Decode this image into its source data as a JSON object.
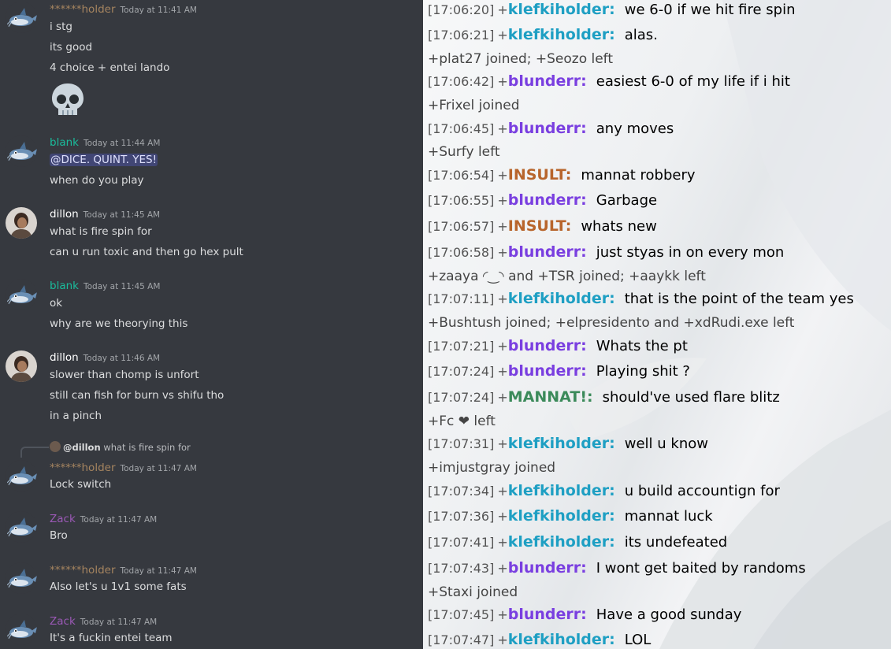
{
  "discord": {
    "colors": {
      "bg": "#36393f",
      "text": "#dcddde",
      "holder": "#a5845f",
      "blank": "#1abc9c",
      "dillon": "#ffffff",
      "zack": "#9b59b6"
    },
    "messages": [
      {
        "user": "******holder",
        "time": "Today at 11:41 AM",
        "lines": [
          "i stg",
          "its good",
          "4 choice + entei lando"
        ],
        "avatar": "fish-avatar"
      },
      {
        "user": "blank",
        "time": "Today at 11:44 AM",
        "mention": "@DICE. QUINT. YES!",
        "lines": [
          "when do you play"
        ],
        "avatar": "fish-avatar"
      },
      {
        "user": "dillon",
        "time": "Today at 11:45 AM",
        "lines": [
          "what is fire spin for",
          "can u run toxic and then go hex pult"
        ],
        "avatar": "person-avatar"
      },
      {
        "user": "blank",
        "time": "Today at 11:45 AM",
        "lines": [
          "ok",
          "why are we theorying this"
        ],
        "avatar": "fish-avatar"
      },
      {
        "user": "dillon",
        "time": "Today at 11:46 AM",
        "lines": [
          "slower than chomp is unfort",
          "still can fish for burn vs shifu tho",
          "in a pinch"
        ],
        "avatar": "person-avatar"
      },
      {
        "user": "******holder",
        "time": "Today at 11:47 AM",
        "reply_user": "@dillon",
        "reply_text": "what is fire spin for",
        "lines": [
          "Lock switch"
        ],
        "avatar": "fish-avatar"
      },
      {
        "user": "Zack",
        "time": "Today at 11:47 AM",
        "lines": [
          "Bro"
        ],
        "avatar": "fish-avatar"
      },
      {
        "user": "******holder",
        "time": "Today at 11:47 AM",
        "lines": [
          "Also let's u 1v1 some fats"
        ],
        "avatar": "fish-avatar"
      },
      {
        "user": "Zack",
        "time": "Today at 11:47 AM",
        "lines": [
          "It's a fuckin entei team"
        ],
        "avatar": "fish-avatar"
      }
    ],
    "emoji": "skull-emoji"
  },
  "showdown": {
    "colors": {
      "klefkiholder": "#1e9fc3",
      "blunderr": "#7a3fe0",
      "INSULT": "#b8652c",
      "MANNAT": "#3b8a5a",
      "time": "#555555"
    },
    "lines": [
      {
        "type": "chat",
        "time": "[17:06:20]",
        "rank": "+",
        "user": "klefkiholder:",
        "msg": "we 6-0 if we hit fire spin"
      },
      {
        "type": "chat",
        "time": "[17:06:21]",
        "rank": "+",
        "user": "klefkiholder:",
        "msg": "alas."
      },
      {
        "type": "join",
        "text": "+plat27 joined; +Seozo left"
      },
      {
        "type": "chat",
        "time": "[17:06:42]",
        "rank": "+",
        "user": "blunderr:",
        "msg": "easiest 6-0 of my life if i hit"
      },
      {
        "type": "join",
        "text": "+Frixel joined"
      },
      {
        "type": "chat",
        "time": "[17:06:45]",
        "rank": "+",
        "user": "blunderr:",
        "msg": "any moves"
      },
      {
        "type": "join",
        "text": "+Surfy left"
      },
      {
        "type": "chat",
        "time": "[17:06:54]",
        "rank": "+",
        "user": "INSULT:",
        "msg": "mannat robbery"
      },
      {
        "type": "chat",
        "time": "[17:06:55]",
        "rank": "+",
        "user": "blunderr:",
        "msg": "Garbage"
      },
      {
        "type": "chat",
        "time": "[17:06:57]",
        "rank": "+",
        "user": "INSULT:",
        "msg": "whats new"
      },
      {
        "type": "chat",
        "time": "[17:06:58]",
        "rank": "+",
        "user": "blunderr:",
        "msg": "just styas in on every mon"
      },
      {
        "type": "join",
        "text": "+zaaya ◜‿◝ and +TSR joined; +aaykk left"
      },
      {
        "type": "chat",
        "time": "[17:07:11]",
        "rank": "+",
        "user": "klefkiholder:",
        "msg": "that is the point of the team yes"
      },
      {
        "type": "join",
        "text": "+Bushtush joined; +elpresidento and +xdRudi.exe left"
      },
      {
        "type": "chat",
        "time": "[17:07:21]",
        "rank": "+",
        "user": "blunderr:",
        "msg": "Whats the pt"
      },
      {
        "type": "chat",
        "time": "[17:07:24]",
        "rank": "+",
        "user": "blunderr:",
        "msg": "Playing shit ?"
      },
      {
        "type": "chat",
        "time": "[17:07:24]",
        "rank": "+",
        "user": "MANNAT!:",
        "msg": "should've used flare blitz"
      },
      {
        "type": "join",
        "text": "+Fc ❤ left"
      },
      {
        "type": "chat",
        "time": "[17:07:31]",
        "rank": "+",
        "user": "klefkiholder:",
        "msg": "well u know"
      },
      {
        "type": "join",
        "text": "+imjustgray joined"
      },
      {
        "type": "chat",
        "time": "[17:07:34]",
        "rank": "+",
        "user": "klefkiholder:",
        "msg": "u build accountign for"
      },
      {
        "type": "chat",
        "time": "[17:07:36]",
        "rank": "+",
        "user": "klefkiholder:",
        "msg": "mannat luck"
      },
      {
        "type": "chat",
        "time": "[17:07:41]",
        "rank": "+",
        "user": "klefkiholder:",
        "msg": "its undefeated"
      },
      {
        "type": "chat",
        "time": "[17:07:43]",
        "rank": "+",
        "user": "blunderr:",
        "msg": "I wont get baited by randoms"
      },
      {
        "type": "join",
        "text": "+Staxi joined"
      },
      {
        "type": "chat",
        "time": "[17:07:45]",
        "rank": "+",
        "user": "blunderr:",
        "msg": "Have a good sunday"
      },
      {
        "type": "chat",
        "time": "[17:07:47]",
        "rank": "+",
        "user": "klefkiholder:",
        "msg": "LOL"
      }
    ]
  }
}
